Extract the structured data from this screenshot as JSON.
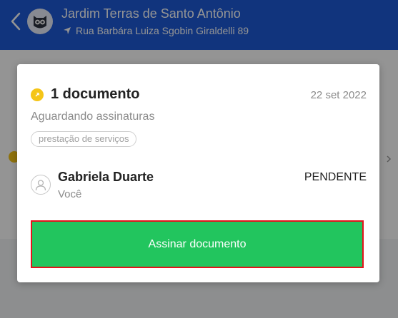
{
  "header": {
    "title": "Jardim Terras de Santo Antônio",
    "address": "Rua Barbára Luiza Sgobin Giraldelli 89",
    "color": "#1e5bd8",
    "back_icon": "chevron-left-icon",
    "avatar_icon": "owl-mascot-icon",
    "location_icon": "navigation-arrow-icon"
  },
  "modal": {
    "document_title": "1 documento",
    "date": "22 set 2022",
    "status": "Aguardando assinaturas",
    "tag": "prestação de serviços",
    "signer": {
      "name": "Gabriela Duarte",
      "role": "Você",
      "status": "PENDENTE"
    },
    "sign_button_label": "Assinar documento",
    "button_color": "#22c55e",
    "highlight_color": "#e3131b"
  }
}
